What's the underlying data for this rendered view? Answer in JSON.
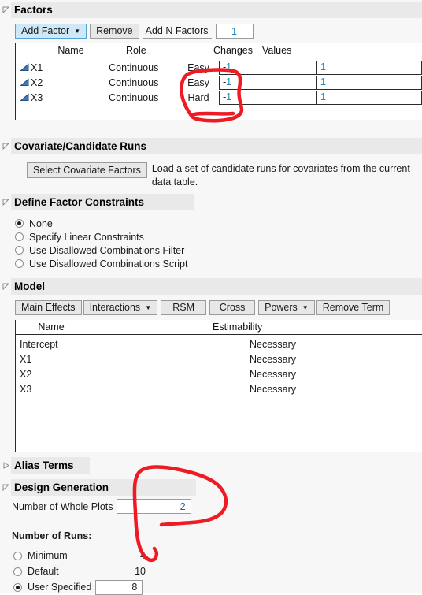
{
  "sections": {
    "factors": {
      "title": "Factors",
      "expanded": true
    },
    "covariate": {
      "title": "Covariate/Candidate Runs",
      "expanded": true
    },
    "constraints": {
      "title": "Define Factor Constraints",
      "expanded": true
    },
    "model": {
      "title": "Model",
      "expanded": true
    },
    "alias": {
      "title": "Alias Terms",
      "expanded": false
    },
    "design_generation": {
      "title": "Design Generation",
      "expanded": true
    }
  },
  "factors": {
    "toolbar": {
      "add_factor": "Add Factor",
      "remove": "Remove",
      "add_n_factors_label": "Add N Factors",
      "add_n_factors_value": "1"
    },
    "columns": [
      "Name",
      "Role",
      "Changes",
      "Values"
    ],
    "rows": [
      {
        "name": "X1",
        "role": "Continuous",
        "changes": "Easy",
        "low": "-1",
        "high": "1"
      },
      {
        "name": "X2",
        "role": "Continuous",
        "changes": "Easy",
        "low": "-1",
        "high": "1"
      },
      {
        "name": "X3",
        "role": "Continuous",
        "changes": "Hard",
        "low": "-1",
        "high": "1"
      }
    ]
  },
  "covariate": {
    "button": "Select Covariate Factors",
    "description_line1": "Load a set of candidate runs for covariates from the current",
    "description_line2": "data table."
  },
  "constraints": {
    "options": [
      {
        "label": "None",
        "selected": true
      },
      {
        "label": "Specify Linear Constraints",
        "selected": false
      },
      {
        "label": "Use Disallowed Combinations Filter",
        "selected": false
      },
      {
        "label": "Use Disallowed Combinations Script",
        "selected": false
      }
    ]
  },
  "model": {
    "toolbar": [
      "Main Effects",
      "Interactions",
      "RSM",
      "Cross",
      "Powers",
      "Remove Term"
    ],
    "columns": [
      "Name",
      "Estimability"
    ],
    "rows": [
      {
        "name": "Intercept",
        "estimability": "Necessary"
      },
      {
        "name": "X1",
        "estimability": "Necessary"
      },
      {
        "name": "X2",
        "estimability": "Necessary"
      },
      {
        "name": "X3",
        "estimability": "Necessary"
      }
    ]
  },
  "design_generation": {
    "whole_plots_label": "Number of Whole Plots",
    "whole_plots_value": "2",
    "number_of_runs_label": "Number of Runs:",
    "runs": [
      {
        "label": "Minimum",
        "value": "4",
        "selected": false,
        "editable": false
      },
      {
        "label": "Default",
        "value": "10",
        "selected": false,
        "editable": false
      },
      {
        "label": "User Specified",
        "value": "8",
        "selected": true,
        "editable": true
      }
    ]
  },
  "annotation": {
    "color": "#ee1b24",
    "marks": [
      "circle-around-changes-column",
      "loop-around-whole-plots"
    ]
  }
}
